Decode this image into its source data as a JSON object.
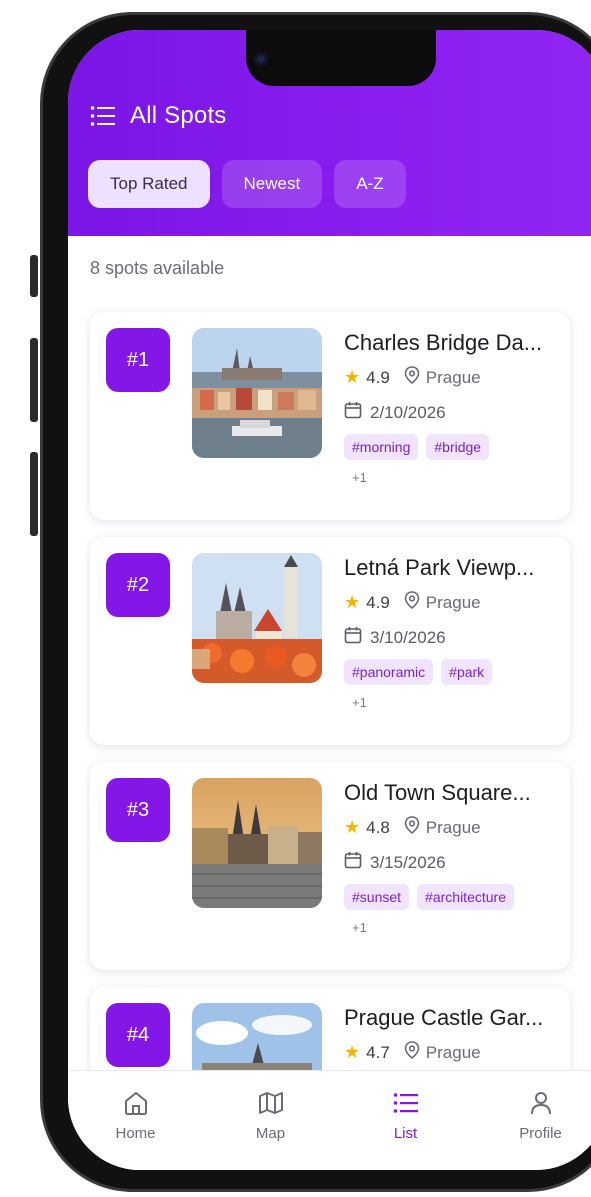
{
  "header": {
    "title": "All Spots"
  },
  "tabs": [
    {
      "label": "Top Rated"
    },
    {
      "label": "Newest"
    },
    {
      "label": "A-Z"
    }
  ],
  "count_text": "8 spots available",
  "spots": [
    {
      "rank": "#1",
      "name": "Charles Bridge Da...",
      "rating": "4.9",
      "location": "Prague",
      "date": "2/10/2026",
      "tags": [
        "#morning",
        "#bridge"
      ],
      "more": "+1"
    },
    {
      "rank": "#2",
      "name": "Letná Park Viewp...",
      "rating": "4.9",
      "location": "Prague",
      "date": "3/10/2026",
      "tags": [
        "#panoramic",
        "#park"
      ],
      "more": "+1"
    },
    {
      "rank": "#3",
      "name": "Old Town Square...",
      "rating": "4.8",
      "location": "Prague",
      "date": "3/15/2026",
      "tags": [
        "#sunset",
        "#architecture"
      ],
      "more": "+1"
    },
    {
      "rank": "#4",
      "name": "Prague Castle Gar...",
      "rating": "4.7",
      "location": "Prague"
    }
  ],
  "nav": [
    {
      "label": "Home",
      "icon": "home-icon"
    },
    {
      "label": "Map",
      "icon": "map-icon"
    },
    {
      "label": "List",
      "icon": "list-icon"
    },
    {
      "label": "Profile",
      "icon": "profile-icon"
    }
  ],
  "colors": {
    "accent": "#8417e8",
    "header_start": "#7a16e6",
    "header_end": "#9126f2",
    "tag_bg": "#f1e4ff",
    "star": "#f5b400"
  }
}
